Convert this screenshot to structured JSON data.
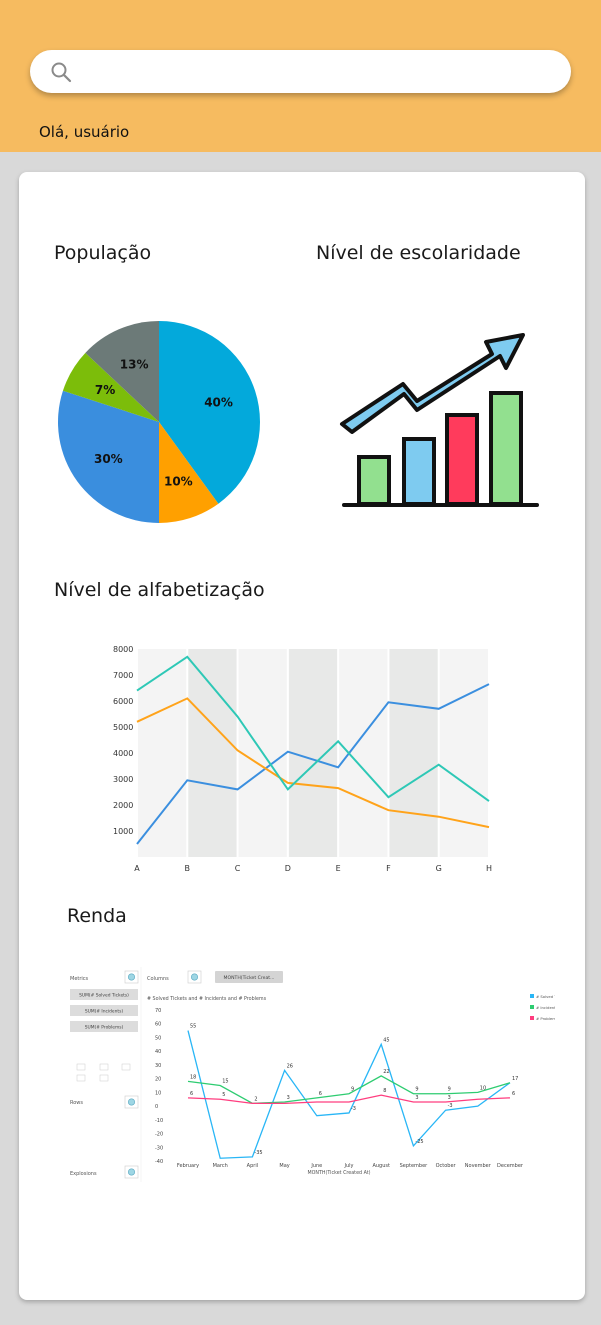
{
  "search": {
    "placeholder": "",
    "value": "",
    "icon": "search-icon"
  },
  "header": {
    "greeting": "Olá, usuário"
  },
  "sections": {
    "populacao": "População",
    "escolaridade": "Nível de escolaridade",
    "alfabetizacao": "Nível de alfabetização",
    "renda": "Renda"
  },
  "colors": {
    "header": "#f6bb60",
    "background": "#d9d9d9"
  },
  "chart_data": [
    {
      "type": "pie",
      "title": "População",
      "slices": [
        {
          "label": "40%",
          "value": 40,
          "color": "#03a9db"
        },
        {
          "label": "10%",
          "value": 10,
          "color": "#ffa000"
        },
        {
          "label": "30%",
          "value": 30,
          "color": "#3a8ede"
        },
        {
          "label": "7%",
          "value": 7,
          "color": "#7cbd0a"
        },
        {
          "label": "13%",
          "value": 13,
          "color": "#6c7a78"
        }
      ]
    },
    {
      "type": "line",
      "title": "Nível de alfabetização",
      "categories": [
        "A",
        "B",
        "C",
        "D",
        "E",
        "F",
        "G",
        "H"
      ],
      "ylim": [
        0,
        8000
      ],
      "yticks": [
        1000,
        2000,
        3000,
        4000,
        5000,
        6000,
        7000,
        8000
      ],
      "series": [
        {
          "color": "#3b8fdf",
          "values": [
            500,
            2950,
            2600,
            4050,
            3450,
            5950,
            5700,
            6650
          ]
        },
        {
          "color": "#ffa31a",
          "values": [
            5200,
            6100,
            4100,
            2850,
            2650,
            1800,
            1550,
            1150
          ]
        },
        {
          "color": "#2ec8b6",
          "values": [
            6400,
            7700,
            5400,
            2600,
            4450,
            2300,
            3550,
            2150
          ]
        }
      ]
    },
    {
      "type": "line",
      "title": "Renda",
      "panel": {
        "metrics": "Metrics",
        "columns": "Columns",
        "column_field": "MONTH(Ticket Creat...",
        "measures": [
          "SUM(# Solved Tickets)",
          "SUM(# Incidents)",
          "SUM(# Problems)"
        ],
        "rows": "Rows",
        "explosions": "Explosions"
      },
      "subtitle": "# Solved Tickets and # Incidents and # Problems",
      "xlabel": "MONTH(Ticket Created At)",
      "categories": [
        "February",
        "March",
        "April",
        "May",
        "June",
        "July",
        "August",
        "September",
        "October",
        "November",
        "December"
      ],
      "ylim": [
        -40,
        70
      ],
      "yticks": [
        70,
        60,
        50,
        40,
        30,
        20,
        10,
        0,
        -10,
        -20,
        -30,
        -40
      ],
      "series": [
        {
          "name": "# Solved Ticke",
          "color": "#29b6f6",
          "values": [
            55,
            -38,
            -37,
            26,
            -7,
            -5,
            45,
            -29,
            -3,
            0,
            17
          ],
          "labels": [
            "55",
            "",
            "-35",
            "26",
            "",
            "-3",
            "45",
            "-25",
            "-3",
            "",
            "17"
          ]
        },
        {
          "name": "# Incidents",
          "color": "#2ecc71",
          "values": [
            18,
            15,
            2,
            3,
            6,
            9,
            22,
            9,
            9,
            10,
            17
          ],
          "labels": [
            "18",
            "15",
            "",
            "3",
            "6",
            "9",
            "22",
            "9",
            "9",
            "10",
            ""
          ]
        },
        {
          "name": "# Problems",
          "color": "#ff3d7f",
          "values": [
            6,
            5,
            2,
            2,
            3,
            3,
            8,
            3,
            3,
            5,
            6
          ],
          "labels": [
            "6",
            "5",
            "2",
            "",
            "",
            "",
            "8",
            "3",
            "3",
            "",
            "6"
          ]
        }
      ]
    }
  ]
}
